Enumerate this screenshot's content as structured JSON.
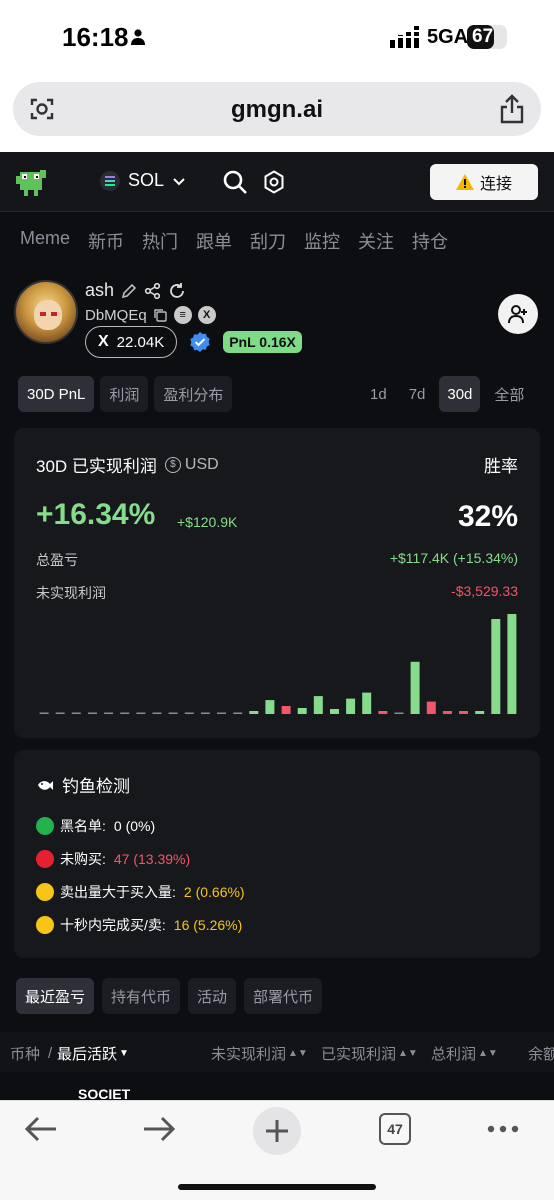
{
  "status_bar": {
    "time": "16:18",
    "network": "5GA",
    "battery": "67",
    "battery_level": 0.67
  },
  "browser": {
    "url": "gmgn.ai",
    "tab_count": "47"
  },
  "header": {
    "chain": "SOL",
    "connect_label": "连接"
  },
  "nav_tabs": [
    "Meme",
    "新币",
    "热门",
    "跟单",
    "刮刀",
    "监控",
    "关注",
    "持仓"
  ],
  "profile": {
    "name": "ash",
    "address": "DbMQEq",
    "x_followers": "22.04K",
    "pnl_badge": "PnL 0.16X"
  },
  "segments": {
    "left": [
      "30D PnL",
      "利润",
      "盈利分布"
    ],
    "right": [
      "1d",
      "7d",
      "30d",
      "全部"
    ],
    "left_active": 0,
    "right_active": 2
  },
  "pnl_card": {
    "title": "30D 已实现利润",
    "currency": "USD",
    "win_label": "胜率",
    "percent": "+16.34%",
    "amount": "+$120.9K",
    "win_rate": "32%",
    "total_label": "总盈亏",
    "total_value": "+$117.4K (+15.34%)",
    "unrealized_label": "未实现利润",
    "unrealized_value": "-$3,529.33",
    "colors": {
      "positive": "#86dc8b",
      "negative": "#f1566a"
    }
  },
  "chart_data": {
    "type": "bar",
    "title": "",
    "xlabel": "",
    "ylabel": "",
    "categories": [
      "1",
      "2",
      "3",
      "4",
      "5",
      "6",
      "7",
      "8",
      "9",
      "10",
      "11",
      "12",
      "13",
      "14",
      "15",
      "16",
      "17",
      "18",
      "19",
      "20",
      "21",
      "22",
      "23",
      "24",
      "25",
      "26",
      "27",
      "28",
      "29",
      "30"
    ],
    "values": [
      0,
      0,
      0,
      0,
      0,
      0,
      0,
      0,
      0,
      0,
      0,
      0,
      0,
      0.3,
      2.8,
      -1.6,
      1.2,
      3.6,
      1.0,
      3.1,
      4.3,
      -0.3,
      0,
      10.5,
      -2.5,
      -0.3,
      -0.3,
      0.1,
      19.1,
      20.1
    ],
    "grid": false,
    "legend": "none"
  },
  "fishing": {
    "title": "钓鱼检测",
    "items": [
      {
        "label": "黑名单:",
        "value": "0 (0%)",
        "dot": "#22b14c",
        "color": "#ffffff"
      },
      {
        "label": "未购买:",
        "value": "47 (13.39%)",
        "dot": "#e5212f",
        "color": "#f1566a"
      },
      {
        "label": "卖出量大于买入量:",
        "value": "2 (0.66%)",
        "dot": "#f5c518",
        "color": "#f5c518"
      },
      {
        "label": "十秒内完成买/卖:",
        "value": "16 (5.26%)",
        "dot": "#f5c518",
        "color": "#f5c518"
      }
    ]
  },
  "bottom_tabs": [
    "最近盈亏",
    "持有代币",
    "活动",
    "部署代币"
  ],
  "table": {
    "headers": [
      "币种",
      "最后活跃",
      "未实现利润",
      "已实现利润",
      "总利润",
      "余额"
    ],
    "first_row_token": "SOCIET"
  }
}
